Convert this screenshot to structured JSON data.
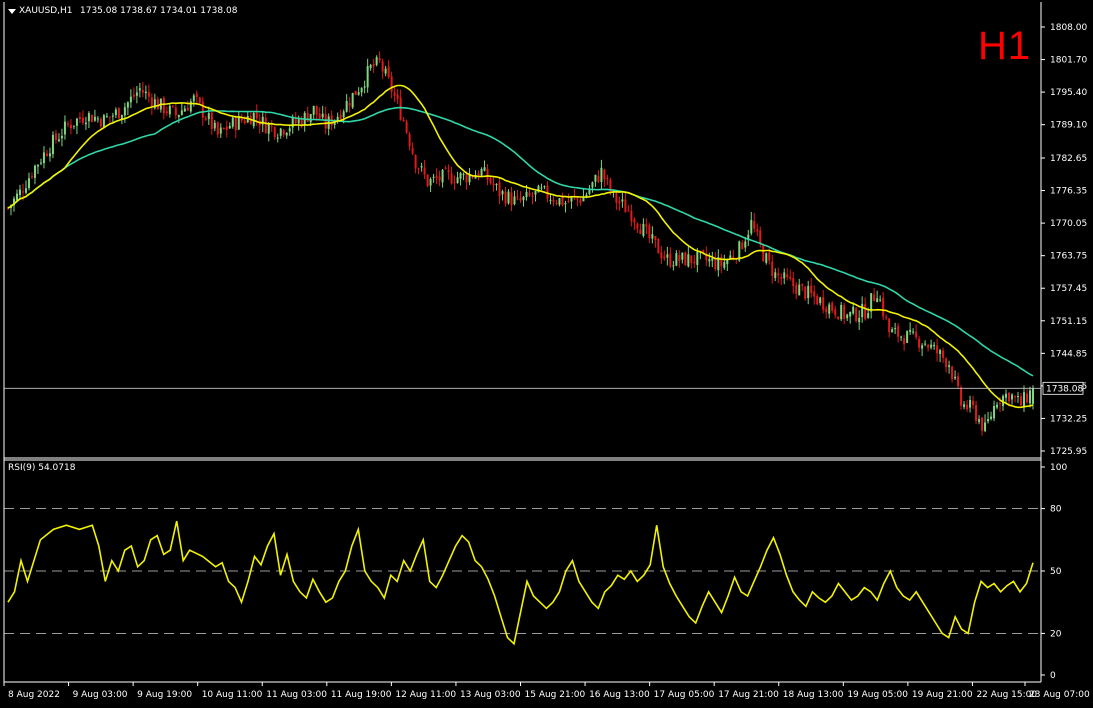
{
  "header": {
    "symbol": "XAUUSD,H1",
    "ohlc": "1735.08 1738.67 1734.01 1738.08",
    "timeframe_badge": "H1",
    "indicator_label": "RSI(9) 54.0718"
  },
  "colors": {
    "background": "#000000",
    "bull_candle": "#7fd67f",
    "bear_candle": "#e11919",
    "ma_fast": "#f2f200",
    "ma_slow": "#2fd6a8",
    "rsi_line": "#f2f200",
    "badge": "#ff0000"
  },
  "chart_data": [
    {
      "type": "candlestick",
      "title": "XAUUSD,H1",
      "current_price": "1738.08",
      "ylim": [
        1725.95,
        1808.0
      ],
      "y_ticks": [
        "1808.00",
        "1801.70",
        "1795.40",
        "1789.10",
        "1782.65",
        "1776.35",
        "1770.05",
        "1763.75",
        "1757.45",
        "1751.15",
        "1744.85",
        "1738.55",
        "1732.25",
        "1725.95"
      ],
      "x_ticks": [
        "8 Aug 2022",
        "9 Aug 03:00",
        "9 Aug 19:00",
        "10 Aug 11:00",
        "11 Aug 03:00",
        "11 Aug 19:00",
        "12 Aug 11:00",
        "13 Aug 03:00",
        "15 Aug 21:00",
        "16 Aug 13:00",
        "17 Aug 05:00",
        "17 Aug 21:00",
        "18 Aug 13:00",
        "19 Aug 05:00",
        "19 Aug 21:00",
        "22 Aug 15:00",
        "23 Aug 07:00"
      ],
      "close_keypoints": [
        [
          0,
          1773
        ],
        [
          4,
          1776
        ],
        [
          9,
          1781
        ],
        [
          14,
          1785
        ],
        [
          20,
          1789
        ],
        [
          26,
          1791
        ],
        [
          32,
          1790
        ],
        [
          38,
          1792
        ],
        [
          44,
          1796
        ],
        [
          50,
          1793
        ],
        [
          56,
          1791
        ],
        [
          62,
          1794
        ],
        [
          67,
          1790
        ],
        [
          70,
          1787
        ],
        [
          74,
          1789
        ],
        [
          78,
          1790
        ],
        [
          82,
          1791
        ],
        [
          86,
          1789
        ],
        [
          90,
          1788
        ],
        [
          94,
          1789
        ],
        [
          98,
          1790
        ],
        [
          102,
          1792
        ],
        [
          106,
          1789
        ],
        [
          110,
          1791
        ],
        [
          114,
          1794
        ],
        [
          118,
          1797
        ],
        [
          121,
          1800
        ],
        [
          124,
          1801
        ],
        [
          128,
          1796
        ],
        [
          132,
          1790
        ],
        [
          136,
          1782
        ],
        [
          140,
          1778
        ],
        [
          146,
          1779
        ],
        [
          152,
          1779
        ],
        [
          158,
          1780
        ],
        [
          164,
          1776
        ],
        [
          170,
          1774
        ],
        [
          178,
          1776
        ],
        [
          186,
          1774
        ],
        [
          192,
          1775
        ],
        [
          198,
          1780
        ],
        [
          202,
          1775
        ],
        [
          208,
          1772
        ],
        [
          214,
          1767
        ],
        [
          220,
          1763
        ],
        [
          226,
          1763
        ],
        [
          232,
          1763
        ],
        [
          238,
          1762
        ],
        [
          244,
          1765
        ],
        [
          248,
          1770
        ],
        [
          252,
          1764
        ],
        [
          256,
          1760
        ],
        [
          262,
          1758
        ],
        [
          268,
          1756
        ],
        [
          274,
          1754
        ],
        [
          280,
          1752
        ],
        [
          286,
          1753
        ],
        [
          290,
          1757
        ],
        [
          294,
          1749
        ],
        [
          300,
          1748
        ],
        [
          306,
          1747
        ],
        [
          310,
          1745
        ],
        [
          314,
          1743
        ],
        [
          318,
          1735
        ],
        [
          322,
          1734
        ],
        [
          326,
          1730
        ],
        [
          330,
          1736
        ],
        [
          334,
          1737
        ],
        [
          338,
          1735
        ],
        [
          342,
          1738
        ]
      ],
      "series": [
        {
          "name": "",
          "kind": "ma_fast",
          "period": 20
        },
        {
          "name": "",
          "kind": "ma_slow",
          "period": 50
        }
      ]
    },
    {
      "type": "line",
      "title": "RSI(9) 54.0718",
      "ylim": [
        0,
        100
      ],
      "y_ticks": [
        "100",
        "80",
        "50",
        "20",
        "0"
      ],
      "levels": [
        80,
        50,
        20
      ],
      "keypoints": [
        [
          0,
          35
        ],
        [
          2,
          40
        ],
        [
          4,
          55
        ],
        [
          6,
          45
        ],
        [
          10,
          65
        ],
        [
          14,
          70
        ],
        [
          18,
          72
        ],
        [
          22,
          70
        ],
        [
          26,
          72
        ],
        [
          28,
          62
        ],
        [
          30,
          45
        ],
        [
          32,
          55
        ],
        [
          34,
          50
        ],
        [
          36,
          60
        ],
        [
          38,
          62
        ],
        [
          40,
          52
        ],
        [
          42,
          55
        ],
        [
          44,
          65
        ],
        [
          46,
          67
        ],
        [
          48,
          58
        ],
        [
          50,
          60
        ],
        [
          52,
          74
        ],
        [
          54,
          55
        ],
        [
          56,
          60
        ],
        [
          60,
          57
        ],
        [
          64,
          52
        ],
        [
          66,
          54
        ],
        [
          68,
          45
        ],
        [
          70,
          42
        ],
        [
          72,
          35
        ],
        [
          74,
          45
        ],
        [
          76,
          57
        ],
        [
          78,
          53
        ],
        [
          80,
          62
        ],
        [
          82,
          68
        ],
        [
          84,
          48
        ],
        [
          86,
          58
        ],
        [
          88,
          45
        ],
        [
          90,
          40
        ],
        [
          92,
          37
        ],
        [
          94,
          46
        ],
        [
          96,
          40
        ],
        [
          98,
          35
        ],
        [
          100,
          37
        ],
        [
          102,
          45
        ],
        [
          104,
          50
        ],
        [
          106,
          62
        ],
        [
          108,
          70
        ],
        [
          110,
          50
        ],
        [
          112,
          45
        ],
        [
          114,
          42
        ],
        [
          116,
          37
        ],
        [
          118,
          48
        ],
        [
          120,
          45
        ],
        [
          122,
          55
        ],
        [
          124,
          50
        ],
        [
          126,
          58
        ],
        [
          128,
          65
        ],
        [
          130,
          45
        ],
        [
          132,
          42
        ],
        [
          134,
          48
        ],
        [
          136,
          55
        ],
        [
          138,
          62
        ],
        [
          140,
          67
        ],
        [
          142,
          64
        ],
        [
          144,
          55
        ],
        [
          146,
          52
        ],
        [
          148,
          46
        ],
        [
          150,
          38
        ],
        [
          152,
          28
        ],
        [
          154,
          18
        ],
        [
          156,
          15
        ],
        [
          158,
          30
        ],
        [
          160,
          45
        ],
        [
          162,
          38
        ],
        [
          164,
          35
        ],
        [
          166,
          32
        ],
        [
          168,
          35
        ],
        [
          170,
          40
        ],
        [
          172,
          50
        ],
        [
          174,
          55
        ],
        [
          176,
          45
        ],
        [
          178,
          40
        ],
        [
          180,
          35
        ],
        [
          182,
          32
        ],
        [
          184,
          40
        ],
        [
          186,
          43
        ],
        [
          188,
          48
        ],
        [
          190,
          46
        ],
        [
          192,
          50
        ],
        [
          194,
          45
        ],
        [
          196,
          48
        ],
        [
          198,
          53
        ],
        [
          200,
          72
        ],
        [
          202,
          52
        ],
        [
          204,
          44
        ],
        [
          206,
          38
        ],
        [
          208,
          33
        ],
        [
          210,
          28
        ],
        [
          212,
          25
        ],
        [
          214,
          33
        ],
        [
          216,
          40
        ],
        [
          218,
          35
        ],
        [
          220,
          30
        ],
        [
          222,
          38
        ],
        [
          224,
          47
        ],
        [
          226,
          40
        ],
        [
          228,
          38
        ],
        [
          230,
          45
        ],
        [
          232,
          52
        ],
        [
          234,
          60
        ],
        [
          236,
          66
        ],
        [
          238,
          58
        ],
        [
          240,
          48
        ],
        [
          242,
          40
        ],
        [
          244,
          36
        ],
        [
          246,
          33
        ],
        [
          248,
          40
        ],
        [
          250,
          37
        ],
        [
          252,
          35
        ],
        [
          254,
          38
        ],
        [
          256,
          44
        ],
        [
          258,
          40
        ],
        [
          260,
          36
        ],
        [
          262,
          38
        ],
        [
          264,
          42
        ],
        [
          266,
          40
        ],
        [
          268,
          36
        ],
        [
          270,
          44
        ],
        [
          272,
          50
        ],
        [
          274,
          42
        ],
        [
          276,
          38
        ],
        [
          278,
          36
        ],
        [
          280,
          40
        ],
        [
          282,
          35
        ],
        [
          284,
          30
        ],
        [
          286,
          25
        ],
        [
          288,
          20
        ],
        [
          290,
          18
        ],
        [
          292,
          28
        ],
        [
          294,
          22
        ],
        [
          296,
          20
        ],
        [
          298,
          35
        ],
        [
          300,
          45
        ],
        [
          302,
          42
        ],
        [
          304,
          44
        ],
        [
          306,
          40
        ],
        [
          308,
          43
        ],
        [
          310,
          45
        ],
        [
          312,
          40
        ],
        [
          314,
          44
        ],
        [
          316,
          54
        ]
      ]
    }
  ]
}
